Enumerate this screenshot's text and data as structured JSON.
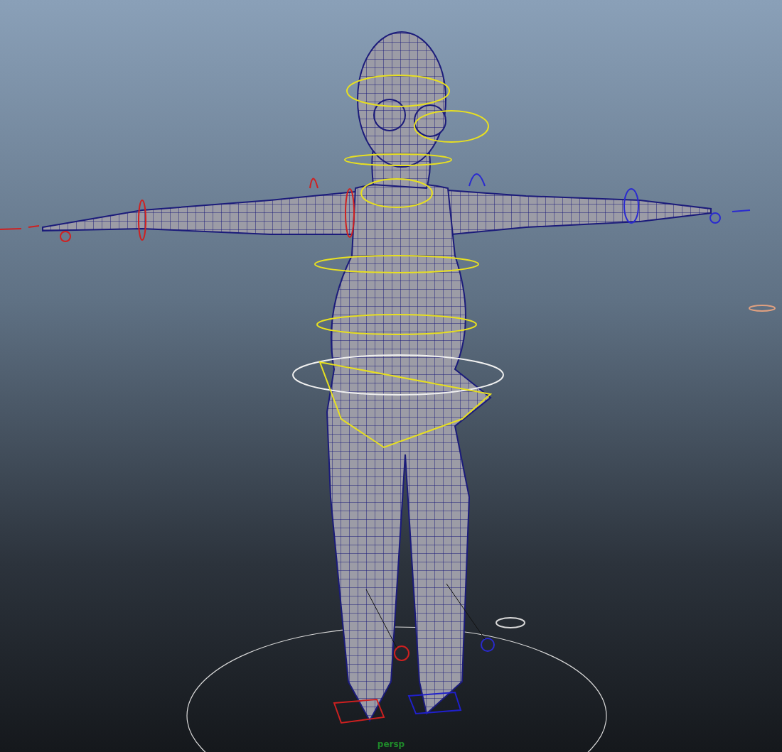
{
  "viewport": {
    "camera": "persp"
  }
}
